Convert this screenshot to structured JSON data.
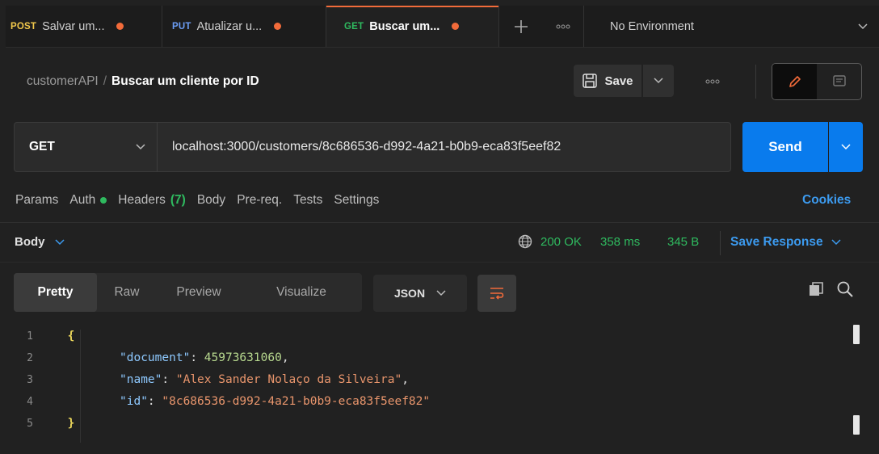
{
  "tabs": [
    {
      "method": "POST",
      "method_color": "#f2c94c",
      "label": "Salvar um...",
      "unsaved": true
    },
    {
      "method": "PUT",
      "method_color": "#6b9df5",
      "label": "Atualizar u...",
      "unsaved": true
    },
    {
      "method": "GET",
      "method_color": "#2fba5f",
      "label": "Buscar um...",
      "unsaved": true,
      "active": true
    }
  ],
  "environment": {
    "label": "No Environment"
  },
  "breadcrumb": {
    "collection": "customerAPI",
    "separator": "/",
    "request": "Buscar um cliente por ID"
  },
  "header": {
    "save_label": "Save"
  },
  "request": {
    "method": "GET",
    "url": "localhost:3000/customers/8c686536-d992-4a21-b0b9-eca83f5eef82",
    "send_label": "Send"
  },
  "request_tabs": {
    "params": "Params",
    "auth": "Auth",
    "headers": "Headers",
    "headers_count": "(7)",
    "body": "Body",
    "prereq": "Pre-req.",
    "tests": "Tests",
    "settings": "Settings",
    "cookies": "Cookies"
  },
  "response": {
    "body_label": "Body",
    "status": "200 OK",
    "time": "358 ms",
    "size": "345 B",
    "save_response": "Save Response"
  },
  "formats": {
    "pretty": "Pretty",
    "raw": "Raw",
    "preview": "Preview",
    "visualize": "Visualize",
    "language": "JSON"
  },
  "code": {
    "lines": [
      "1",
      "2",
      "3",
      "4",
      "5"
    ],
    "open_brace": "{",
    "close_brace": "}",
    "fields": [
      {
        "key": "\"document\"",
        "value": "45973631060",
        "type": "number",
        "comma": ","
      },
      {
        "key": "\"name\"",
        "value": "\"Alex Sander Nolaço da Silveira\"",
        "type": "string",
        "comma": ","
      },
      {
        "key": "\"id\"",
        "value": "\"8c686536-d992-4a21-b0b9-eca83f5eef82\"",
        "type": "string",
        "comma": ""
      }
    ]
  },
  "colors": {
    "accent": "#097bed",
    "status_green": "#2fba5f",
    "unsaved_dot": "#f26b3a"
  }
}
